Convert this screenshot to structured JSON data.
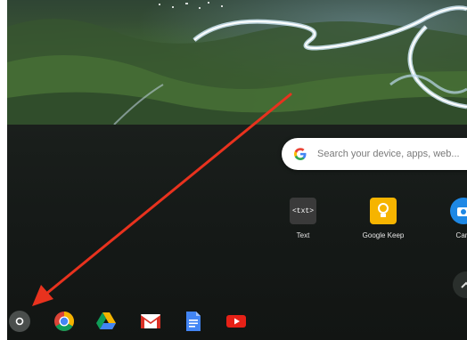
{
  "search": {
    "placeholder": "Search your device, apps, web..."
  },
  "apps": [
    {
      "name": "Text",
      "icon": "text-app-icon",
      "color": "#333333"
    },
    {
      "name": "Google Keep",
      "icon": "keep-icon",
      "color": "#f6b400"
    },
    {
      "name": "Cam",
      "icon": "camera-icon",
      "color": "#1e88e5"
    }
  ],
  "shelf": {
    "items": [
      {
        "icon": "launcher-icon"
      },
      {
        "icon": "chrome-icon"
      },
      {
        "icon": "drive-icon"
      },
      {
        "icon": "gmail-icon"
      },
      {
        "icon": "docs-icon"
      },
      {
        "icon": "youtube-icon"
      }
    ]
  },
  "annotation": {
    "arrow_color": "#e8321e"
  }
}
